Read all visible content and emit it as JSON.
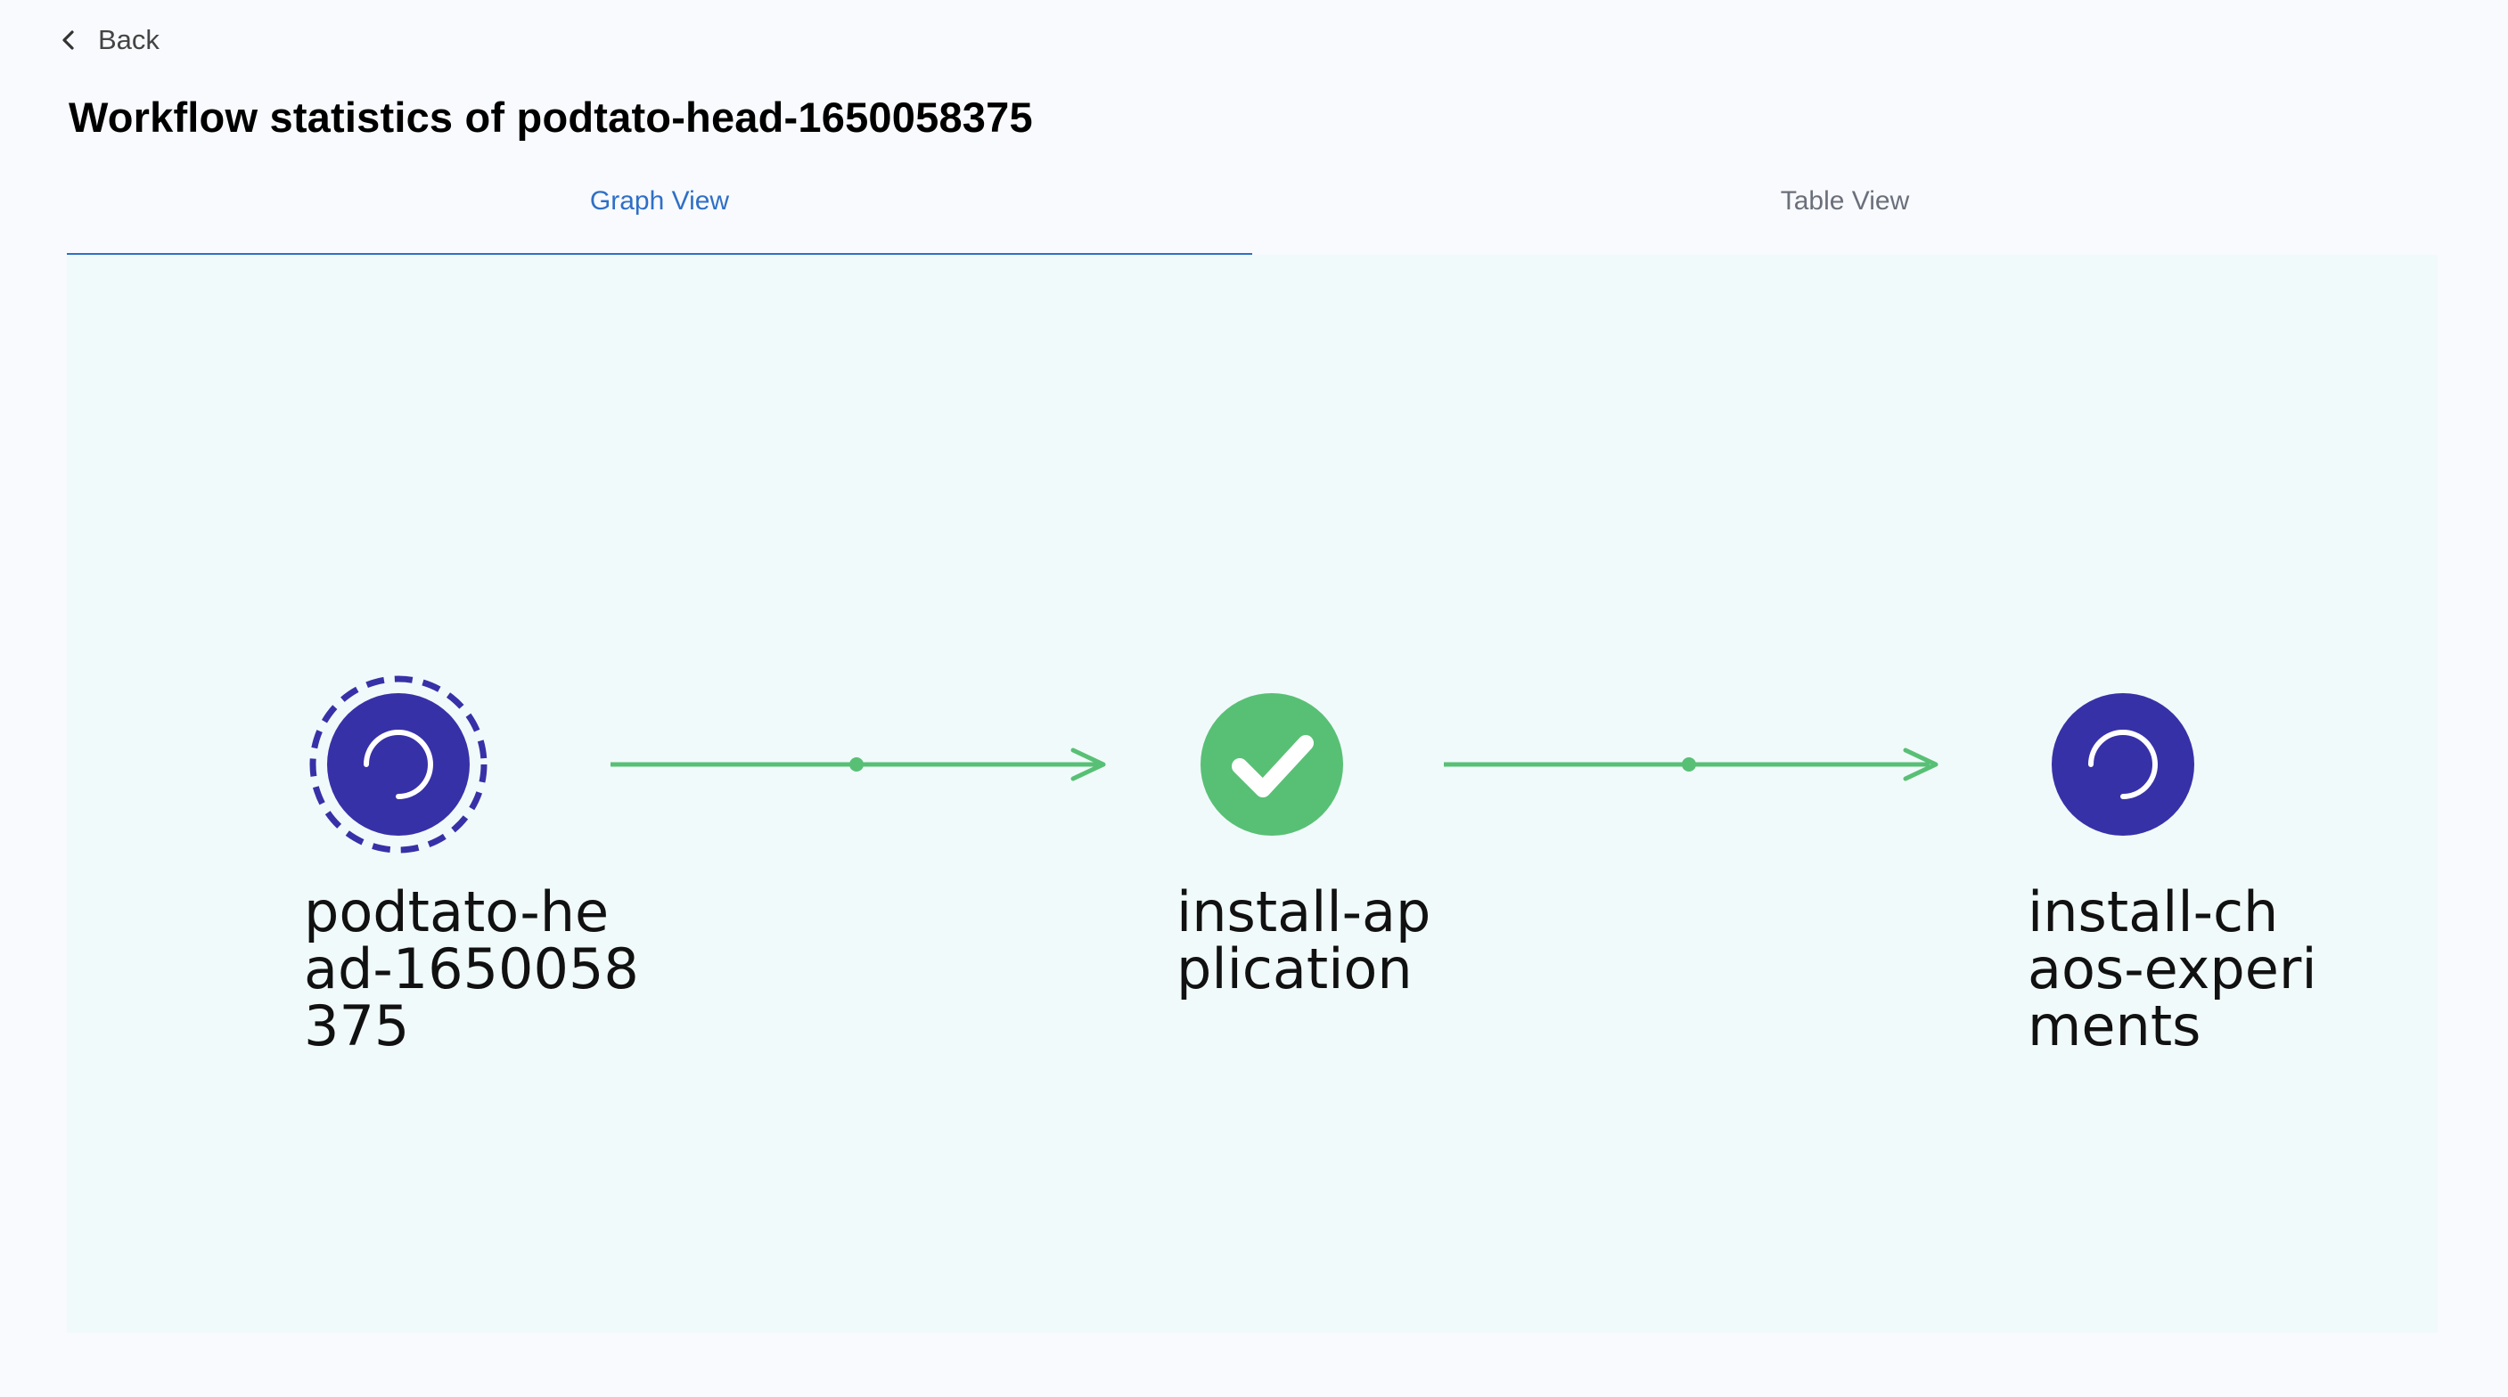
{
  "back": {
    "label": "Back"
  },
  "page": {
    "title": "Workflow statistics of podtato-head-1650058375"
  },
  "tabs": [
    {
      "label": "Graph View",
      "active": true
    },
    {
      "label": "Table View",
      "active": false
    }
  ],
  "graph": {
    "nodes": [
      {
        "label": "podtato-he\nad-1650058\n375",
        "status": "running",
        "icon": "spinner-icon"
      },
      {
        "label": "install-ap\nplication",
        "status": "succeeded",
        "icon": "check-icon"
      },
      {
        "label": "install-ch\naos-experi\nments",
        "status": "running",
        "icon": "spinner-icon"
      }
    ],
    "colors": {
      "node_fill": "#3731a8",
      "success_fill": "#58c075",
      "edge": "#58c075"
    }
  }
}
